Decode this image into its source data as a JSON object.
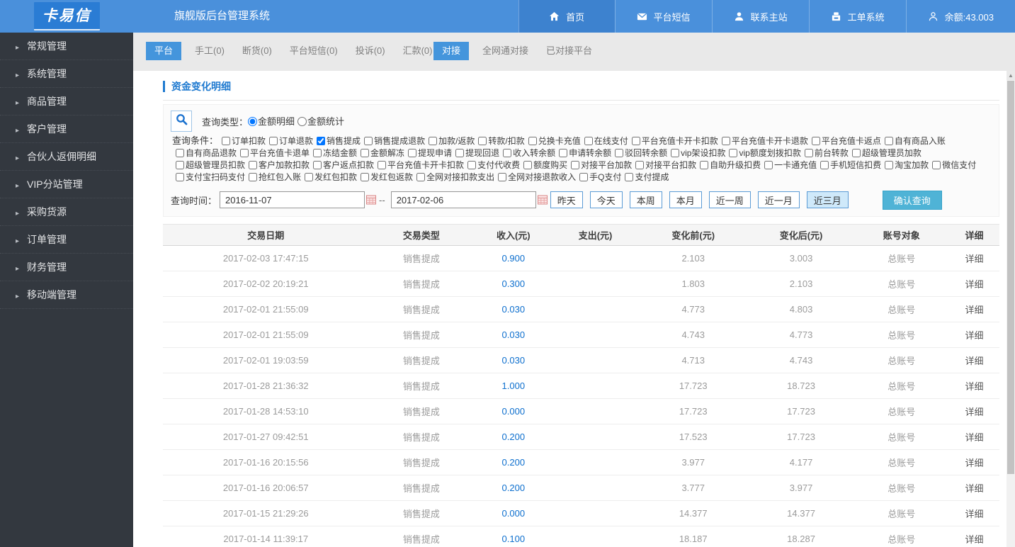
{
  "header": {
    "logo": "卡易信",
    "title": "旗舰版后台管理系统",
    "nav": [
      {
        "label": "首页",
        "icon": "home-icon",
        "active": true
      },
      {
        "label": "平台短信",
        "icon": "sms-icon",
        "active": false
      },
      {
        "label": "联系主站",
        "icon": "contact-icon",
        "active": false
      },
      {
        "label": "工单系统",
        "icon": "ticket-icon",
        "active": false
      },
      {
        "label": "余额:43.003",
        "icon": "user-icon",
        "active": false
      }
    ]
  },
  "sidebar": {
    "items": [
      "常规管理",
      "系统管理",
      "商品管理",
      "客户管理",
      "合伙人返佣明细",
      "VIP分站管理",
      "采购货源",
      "订单管理",
      "财务管理",
      "移动端管理"
    ]
  },
  "subnav": {
    "left": [
      {
        "label": "平台",
        "active": true
      },
      {
        "label": "手工(0)",
        "active": false
      },
      {
        "label": "断货(0)",
        "active": false
      },
      {
        "label": "平台短信(0)",
        "active": false
      },
      {
        "label": "投诉(0)",
        "active": false
      },
      {
        "label": "汇款(0)",
        "active": false
      }
    ],
    "right": [
      {
        "label": "对接",
        "active": true
      },
      {
        "label": "全网通对接",
        "active": false
      },
      {
        "label": "已对接平台",
        "active": false
      }
    ]
  },
  "page": {
    "title": "资金变化明细"
  },
  "filters": {
    "type_label": "查询类型：",
    "type_options": [
      {
        "label": "金额明细",
        "selected": true
      },
      {
        "label": "金额统计",
        "selected": false
      }
    ],
    "condition_label": "查询条件：",
    "conditions": [
      {
        "label": "订单扣款",
        "checked": false
      },
      {
        "label": "订单退款",
        "checked": false
      },
      {
        "label": "销售提成",
        "checked": true
      },
      {
        "label": "销售提成退款",
        "checked": false
      },
      {
        "label": "加款/返款",
        "checked": false
      },
      {
        "label": "转款/扣款",
        "checked": false
      },
      {
        "label": "兑换卡充值",
        "checked": false
      },
      {
        "label": "在线支付",
        "checked": false
      },
      {
        "label": "平台充值卡开卡扣款",
        "checked": false
      },
      {
        "label": "平台充值卡开卡退款",
        "checked": false
      },
      {
        "label": "平台充值卡返点",
        "checked": false
      },
      {
        "label": "自有商品入账",
        "checked": false
      },
      {
        "label": "自有商品退款",
        "checked": false
      },
      {
        "label": "平台充值卡退单",
        "checked": false
      },
      {
        "label": "冻结金额",
        "checked": false
      },
      {
        "label": "金额解冻",
        "checked": false
      },
      {
        "label": "提现申请",
        "checked": false
      },
      {
        "label": "提现回退",
        "checked": false
      },
      {
        "label": "收入转余额",
        "checked": false
      },
      {
        "label": "申请转余额",
        "checked": false
      },
      {
        "label": "驳回转余额",
        "checked": false
      },
      {
        "label": "vip架设扣款",
        "checked": false
      },
      {
        "label": "vip额度划拨扣款",
        "checked": false
      },
      {
        "label": "前台转款",
        "checked": false
      },
      {
        "label": "超级管理员加款",
        "checked": false
      },
      {
        "label": "超级管理员扣款",
        "checked": false
      },
      {
        "label": "客户加款扣款",
        "checked": false
      },
      {
        "label": "客户返点扣款",
        "checked": false
      },
      {
        "label": "平台充值卡开卡扣款",
        "checked": false
      },
      {
        "label": "支付代收费",
        "checked": false
      },
      {
        "label": "额度购买",
        "checked": false
      },
      {
        "label": "对接平台加款",
        "checked": false
      },
      {
        "label": "对接平台扣款",
        "checked": false
      },
      {
        "label": "自助升级扣费",
        "checked": false
      },
      {
        "label": "一卡通充值",
        "checked": false
      },
      {
        "label": "手机短信扣费",
        "checked": false
      },
      {
        "label": "淘宝加款",
        "checked": false
      },
      {
        "label": "微信支付",
        "checked": false
      },
      {
        "label": "支付宝扫码支付",
        "checked": false
      },
      {
        "label": "抢红包入账",
        "checked": false
      },
      {
        "label": "发红包扣款",
        "checked": false
      },
      {
        "label": "发红包返款",
        "checked": false
      },
      {
        "label": "全网对接扣款支出",
        "checked": false
      },
      {
        "label": "全网对接退款收入",
        "checked": false
      },
      {
        "label": "手Q支付",
        "checked": false
      },
      {
        "label": "支付提成",
        "checked": false
      }
    ],
    "time_label": "查询时间：",
    "date_from": "2016-11-07",
    "date_to": "2017-02-06",
    "range_separator": "--",
    "quick_ranges": [
      {
        "label": "昨天",
        "active": false
      },
      {
        "label": "今天",
        "active": false
      },
      {
        "label": "本周",
        "active": false
      },
      {
        "label": "本月",
        "active": false
      },
      {
        "label": "近一周",
        "active": false
      },
      {
        "label": "近一月",
        "active": false
      },
      {
        "label": "近三月",
        "active": true
      }
    ],
    "submit_label": "确认查询"
  },
  "table": {
    "columns": [
      "交易日期",
      "交易类型",
      "收入(元)",
      "支出(元)",
      "变化前(元)",
      "变化后(元)",
      "账号对象",
      "详细"
    ],
    "rows": [
      [
        "2017-02-03 17:47:15",
        "销售提成",
        "0.900",
        "",
        "2.103",
        "3.003",
        "总账号",
        "详细"
      ],
      [
        "2017-02-02 20:19:21",
        "销售提成",
        "0.300",
        "",
        "1.803",
        "2.103",
        "总账号",
        "详细"
      ],
      [
        "2017-02-01 21:55:09",
        "销售提成",
        "0.030",
        "",
        "4.773",
        "4.803",
        "总账号",
        "详细"
      ],
      [
        "2017-02-01 21:55:09",
        "销售提成",
        "0.030",
        "",
        "4.743",
        "4.773",
        "总账号",
        "详细"
      ],
      [
        "2017-02-01 19:03:59",
        "销售提成",
        "0.030",
        "",
        "4.713",
        "4.743",
        "总账号",
        "详细"
      ],
      [
        "2017-01-28 21:36:32",
        "销售提成",
        "1.000",
        "",
        "17.723",
        "18.723",
        "总账号",
        "详细"
      ],
      [
        "2017-01-28 14:53:10",
        "销售提成",
        "0.000",
        "",
        "17.723",
        "17.723",
        "总账号",
        "详细"
      ],
      [
        "2017-01-27 09:42:51",
        "销售提成",
        "0.200",
        "",
        "17.523",
        "17.723",
        "总账号",
        "详细"
      ],
      [
        "2017-01-16 20:15:56",
        "销售提成",
        "0.200",
        "",
        "3.977",
        "4.177",
        "总账号",
        "详细"
      ],
      [
        "2017-01-16 20:06:57",
        "销售提成",
        "0.200",
        "",
        "3.777",
        "3.977",
        "总账号",
        "详细"
      ],
      [
        "2017-01-15 21:29:26",
        "销售提成",
        "0.000",
        "",
        "14.377",
        "14.377",
        "总账号",
        "详细"
      ],
      [
        "2017-01-14 11:39:17",
        "销售提成",
        "0.100",
        "",
        "18.187",
        "18.287",
        "总账号",
        "详细"
      ]
    ]
  },
  "colors": {
    "accent": "#4a90db",
    "topnav_active": "#3d82cf",
    "subnav_active": "#4495dc",
    "sidebar_bg": "#33383f",
    "confirm_button": "#4fb3d6",
    "income_text": "#0d6fce",
    "page_title": "#1f7ad0"
  }
}
